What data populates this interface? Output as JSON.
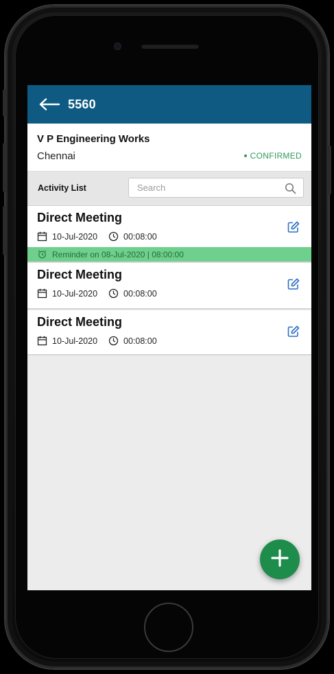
{
  "header": {
    "title": "5560",
    "back_icon": "arrow-left-icon"
  },
  "company": {
    "name": "V P Engineering Works",
    "city": "Chennai",
    "status": "CONFIRMED"
  },
  "activity_bar": {
    "title": "Activity List",
    "search_placeholder": "Search"
  },
  "activities": [
    {
      "title": "Direct Meeting",
      "date": "10-Jul-2020",
      "time": "00:08:00",
      "reminder": "Reminder on 08-Jul-2020 | 08:00:00"
    },
    {
      "title": "Direct Meeting",
      "date": "10-Jul-2020",
      "time": "00:08:00"
    },
    {
      "title": "Direct Meeting",
      "date": "10-Jul-2020",
      "time": "00:08:00"
    }
  ],
  "colors": {
    "appbar": "#0e5a83",
    "status": "#2e9a5a",
    "reminder_bg": "#6fcf8c",
    "fab": "#1e8c4a",
    "edit_icon": "#2a6fc4"
  }
}
